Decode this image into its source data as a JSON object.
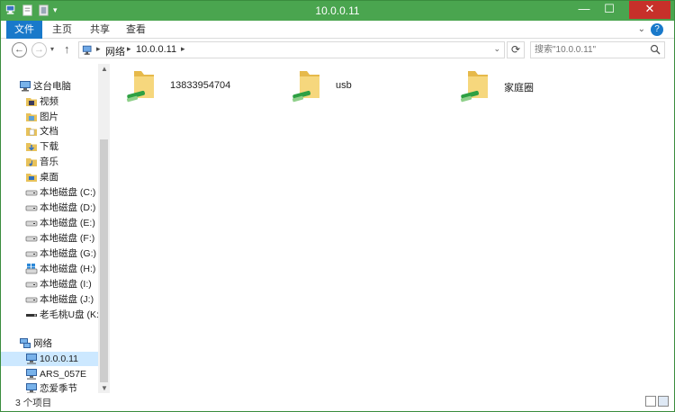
{
  "window": {
    "title": "10.0.0.11"
  },
  "title_controls": {
    "minimize": "—",
    "maximize": "☐",
    "close": "✕"
  },
  "ribbon": {
    "tabs": [
      {
        "label": "文件",
        "active": true
      },
      {
        "label": "主页",
        "active": false
      },
      {
        "label": "共享",
        "active": false
      },
      {
        "label": "查看",
        "active": false
      }
    ],
    "expand": "⌄",
    "help": "?"
  },
  "address": {
    "back": "←",
    "forward": "→",
    "recent": "▾",
    "up": "↑",
    "breadcrumbs": [
      "网络",
      "10.0.0.11"
    ],
    "separator": "▸",
    "dropdown": "⌄",
    "refresh": "⟳",
    "search_placeholder": "搜索\"10.0.0.11\""
  },
  "nav": {
    "items": [
      {
        "label": "这台电脑",
        "icon": "computer-icon",
        "level": 0
      },
      {
        "label": "视频",
        "icon": "video-folder-icon",
        "level": 1
      },
      {
        "label": "图片",
        "icon": "pictures-folder-icon",
        "level": 1
      },
      {
        "label": "文档",
        "icon": "documents-folder-icon",
        "level": 1
      },
      {
        "label": "下载",
        "icon": "downloads-folder-icon",
        "level": 1
      },
      {
        "label": "音乐",
        "icon": "music-folder-icon",
        "level": 1
      },
      {
        "label": "桌面",
        "icon": "desktop-folder-icon",
        "level": 1
      },
      {
        "label": "本地磁盘 (C:)",
        "icon": "drive-icon",
        "level": 1
      },
      {
        "label": "本地磁盘 (D:)",
        "icon": "drive-icon",
        "level": 1
      },
      {
        "label": "本地磁盘 (E:)",
        "icon": "drive-icon",
        "level": 1
      },
      {
        "label": "本地磁盘 (F:)",
        "icon": "drive-icon",
        "level": 1
      },
      {
        "label": "本地磁盘 (G:)",
        "icon": "drive-icon",
        "level": 1
      },
      {
        "label": "本地磁盘 (H:)",
        "icon": "windows-drive-icon",
        "level": 1
      },
      {
        "label": "本地磁盘 (I:)",
        "icon": "drive-icon",
        "level": 1
      },
      {
        "label": "本地磁盘 (J:)",
        "icon": "drive-icon",
        "level": 1
      },
      {
        "label": "老毛桃U盘 (K:)",
        "icon": "usb-drive-icon",
        "level": 1
      },
      {
        "label": "网络",
        "icon": "network-icon",
        "level": 0
      },
      {
        "label": "10.0.0.11",
        "icon": "network-computer-icon",
        "level": 1,
        "selected": true
      },
      {
        "label": "ARS_057E",
        "icon": "network-computer-icon",
        "level": 1
      },
      {
        "label": "恋爱季节",
        "icon": "network-computer-icon",
        "level": 1
      }
    ]
  },
  "files": [
    {
      "name": "13833954704",
      "icon": "shared-folder-icon"
    },
    {
      "name": "usb",
      "icon": "shared-folder-icon"
    },
    {
      "name": "家庭圈",
      "icon": "shared-folder-icon"
    }
  ],
  "status": {
    "count": "3 个项目"
  },
  "colors": {
    "titlebar": "#4aa54f",
    "accent": "#1979ca",
    "selected": "#cce8ff",
    "close": "#c7302a"
  }
}
